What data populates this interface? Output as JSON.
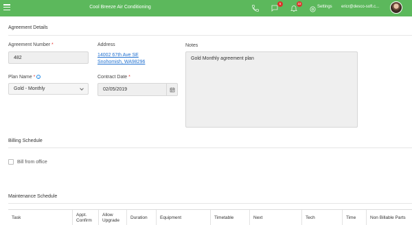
{
  "topbar": {
    "title": "Cool Breeze Air Conditioning",
    "phone_icon": "phone-icon",
    "chat_badge": "5",
    "notifications_badge": "22",
    "settings_label": "Settings",
    "user_email": "ericr@desco-soft.c..."
  },
  "agreement": {
    "section_title": "Agreement Details",
    "number_label": "Agreement Number",
    "number_value": "482",
    "address_label": "Address",
    "address_line1": "14002 67th Ave SE",
    "address_line2": "Snohomish, WA98296",
    "notes_label": "Notes",
    "notes_value": "Gold Monthly agreement plan",
    "plan_label": "Plan Name",
    "plan_value": "Gold - Monthly",
    "contract_label": "Contract Date",
    "contract_value": "02/05/2019",
    "required_mark": "*"
  },
  "billing": {
    "section_title": "Billing Schedule",
    "bill_from_office_label": "Bill from office",
    "bill_from_office_checked": false
  },
  "maintenance": {
    "section_title": "Maintenance Schedule",
    "columns": [
      "Task",
      "Appt. Confirm",
      "Allow Upgrade",
      "Duration",
      "Equipment",
      "Timetable",
      "Next",
      "Tech",
      "Time",
      "Non Billable Parts"
    ]
  },
  "colors": {
    "topbar": "#5cb85c",
    "link": "#1e6fd0",
    "badge": "#d9342b",
    "required": "#e53935"
  }
}
